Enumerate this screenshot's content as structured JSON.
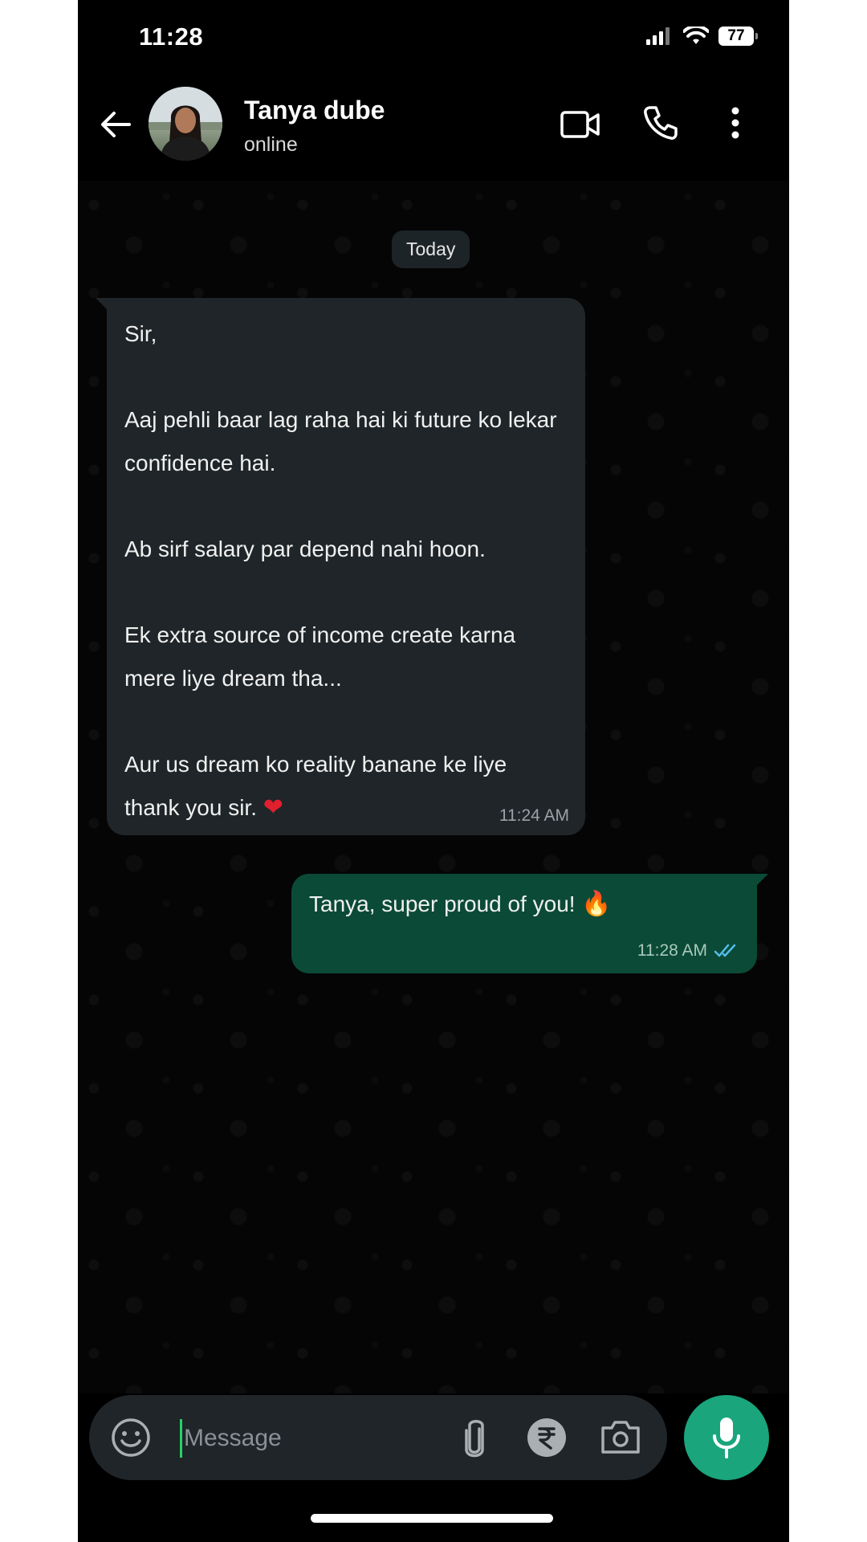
{
  "status_bar": {
    "time": "11:28",
    "battery": "77",
    "icons": [
      "signal-icon",
      "wifi-icon",
      "battery-icon"
    ]
  },
  "header": {
    "contact_name": "Tanya dube",
    "contact_status": "online",
    "icons": [
      "back-arrow-icon",
      "video-call-icon",
      "phone-call-icon",
      "more-options-icon"
    ]
  },
  "date_chip": "Today",
  "messages": [
    {
      "direction": "incoming",
      "paragraphs": [
        "Sir,",
        "Aaj pehli baar lag raha hai ki future ko lekar confidence hai.",
        "Ab sirf salary par depend nahi hoon.",
        "Ek extra source of income create karna mere liye dream tha...",
        "Aur us dream ko reality banane ke liye thank you sir."
      ],
      "emoji": "❤",
      "time": "11:24 AM"
    },
    {
      "direction": "outgoing",
      "text": "Tanya, super proud of you!",
      "emoji": "🔥",
      "time": "11:28 AM",
      "read_receipt": "double-check-icon"
    }
  ],
  "composer": {
    "placeholder": "Message",
    "value": "",
    "icons": [
      "emoji-icon",
      "attachment-icon",
      "rupee-payment-icon",
      "camera-icon",
      "microphone-icon"
    ]
  },
  "colors": {
    "background": "#000000",
    "incoming_bubble": "#1f2528",
    "outgoing_bubble": "#0b4a36",
    "accent": "#1aa57c",
    "read_tick": "#53bdeb"
  }
}
